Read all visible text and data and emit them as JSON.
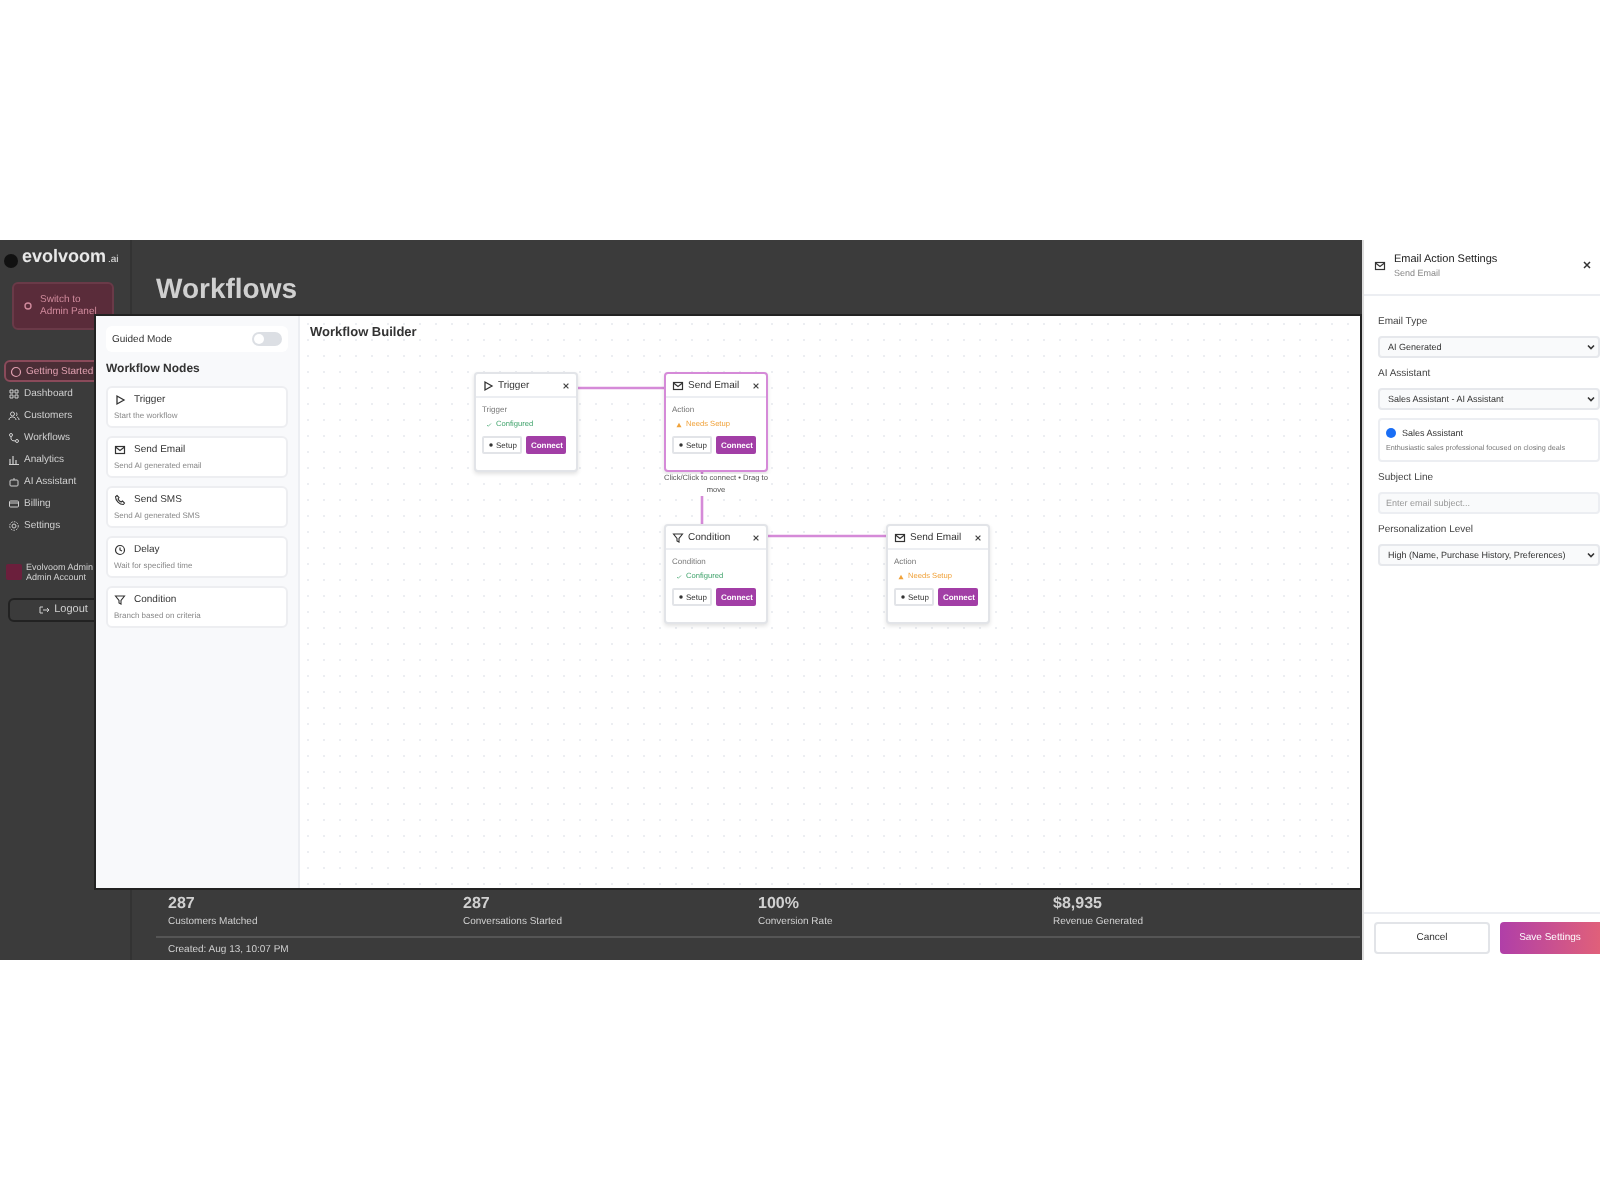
{
  "app": {
    "logo": {
      "name": "evolvoom",
      "suffix": ".ai"
    },
    "admin_button": "Switch to Admin Panel",
    "nav": [
      {
        "label": "Getting Started",
        "selected": true
      },
      {
        "label": "Dashboard",
        "selected": false
      },
      {
        "label": "Customers",
        "selected": false
      },
      {
        "label": "Workflows",
        "selected": false
      },
      {
        "label": "Analytics",
        "selected": false
      },
      {
        "label": "AI Assistant",
        "selected": false
      },
      {
        "label": "Billing",
        "selected": false
      },
      {
        "label": "Settings",
        "selected": false
      }
    ],
    "user": {
      "name": "Evolvoom Admin",
      "role": "Admin Account"
    },
    "logout": "Logout",
    "page_title": "Workflows",
    "stats": [
      {
        "value": "287",
        "label": "Customers Matched"
      },
      {
        "value": "287",
        "label": "Conversations Started"
      },
      {
        "value": "100%",
        "label": "Conversion Rate"
      },
      {
        "value": "$8,935",
        "label": "Revenue Generated"
      }
    ],
    "created": "Created: Aug 13, 10:07 PM"
  },
  "builder": {
    "guided_mode": {
      "label": "Guided Mode",
      "on": false
    },
    "nodes_heading": "Workflow Nodes",
    "palette": [
      {
        "kind": "trigger",
        "title": "Trigger",
        "description": "Start the workflow"
      },
      {
        "kind": "email",
        "title": "Send Email",
        "description": "Send AI generated email"
      },
      {
        "kind": "sms",
        "title": "Send SMS",
        "description": "Send AI generated SMS"
      },
      {
        "kind": "delay",
        "title": "Delay",
        "description": "Wait for specified time"
      },
      {
        "kind": "condition",
        "title": "Condition",
        "description": "Branch based on criteria"
      }
    ],
    "canvas_title": "Workflow Builder",
    "nodes": [
      {
        "kind": "trigger",
        "title": "Trigger",
        "type": "Trigger",
        "configured": true,
        "status_text": "Configured",
        "selected": false,
        "setup": "Setup",
        "connect": "Connect"
      },
      {
        "kind": "email",
        "title": "Send Email",
        "type": "Action",
        "configured": false,
        "status_text": "Needs Setup",
        "selected": true,
        "setup": "Setup",
        "connect": "Connect"
      },
      {
        "kind": "condition",
        "title": "Condition",
        "type": "Condition",
        "configured": true,
        "status_text": "Configured",
        "selected": false,
        "setup": "Setup",
        "connect": "Connect"
      },
      {
        "kind": "email",
        "title": "Send Email",
        "type": "Action",
        "configured": false,
        "status_text": "Needs Setup",
        "selected": false,
        "setup": "Setup",
        "connect": "Connect"
      }
    ],
    "hint": "Click/Click to connect • Drag to move"
  },
  "settings": {
    "title": "Email Action Settings",
    "subtitle": "Send Email",
    "fields": [
      {
        "kind": "select",
        "label": "Email Type",
        "value": "AI Generated"
      },
      {
        "kind": "select",
        "label": "AI Assistant",
        "value": "Sales Assistant - AI Assistant"
      },
      {
        "kind": "assistant",
        "name": "Sales Assistant",
        "description": "Enthusiastic sales professional focused on closing deals",
        "color": "#1a6ef5"
      },
      {
        "kind": "input",
        "label": "Subject Line",
        "placeholder": "Enter email subject..."
      },
      {
        "kind": "select",
        "label": "Personalization Level",
        "value": "High (Name, Purchase History, Preferences)"
      }
    ],
    "cancel": "Cancel",
    "save": "Save Settings"
  }
}
